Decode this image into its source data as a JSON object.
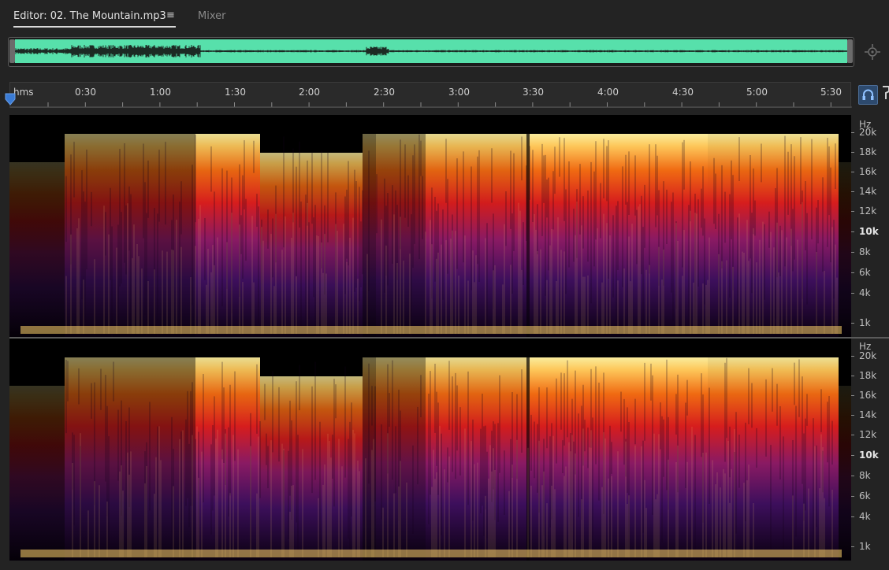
{
  "tabs": {
    "editor_label": "Editor: 02. The Mountain.mp3",
    "menu_glyph": "≡",
    "mixer_label": "Mixer"
  },
  "colors": {
    "waveform": "#57e0ab",
    "background": "#232323",
    "accent": "#2d4a6e"
  },
  "timeline": {
    "unit_label": "hms",
    "ticks": [
      "0:30",
      "1:00",
      "1:30",
      "2:00",
      "2:30",
      "3:00",
      "3:30",
      "4:00",
      "4:30",
      "5:00",
      "5:30"
    ]
  },
  "frequency_axis": {
    "unit_label": "Hz",
    "labels": [
      "20k",
      "18k",
      "16k",
      "14k",
      "12k",
      "10k",
      "8k",
      "6k",
      "4k",
      "1k"
    ]
  },
  "icons": {
    "zoom": "zoom-to-fit-icon",
    "snap": "headphones-snap-icon",
    "marker": "marker-icon",
    "playhead": "playhead-icon"
  }
}
